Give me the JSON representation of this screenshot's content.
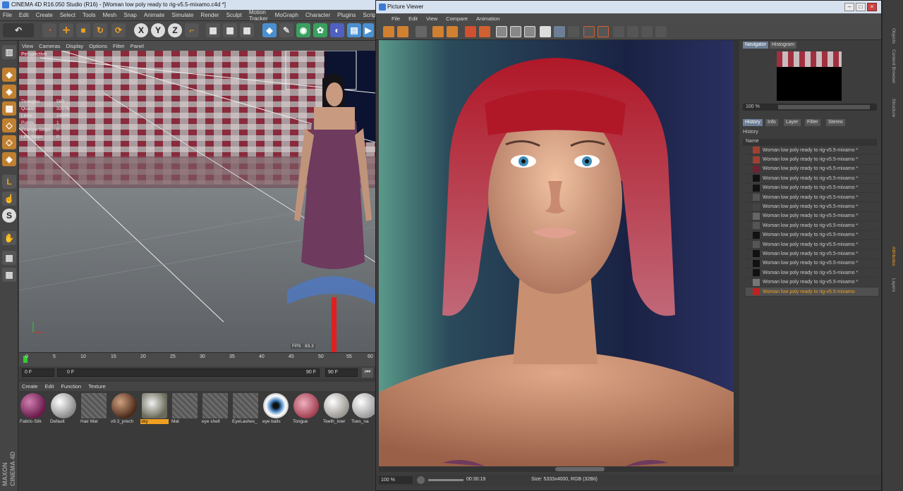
{
  "main_window": {
    "title": "CINEMA 4D R16.050 Studio (R16) - [Woman low poly ready to rig-v5.5-mixamo.c4d *]",
    "menu": [
      "File",
      "Edit",
      "Create",
      "Select",
      "Tools",
      "Mesh",
      "Snap",
      "Animate",
      "Simulate",
      "Render",
      "Sculpt",
      "Motion Tracker",
      "MoGraph",
      "Character",
      "Plugins",
      "Script"
    ]
  },
  "toolbar": {
    "x_label": "X",
    "y_label": "Y",
    "z_label": "Z"
  },
  "viewport": {
    "menu": [
      "View",
      "Cameras",
      "Display",
      "Options",
      "Filter",
      "Panel"
    ],
    "name": "Perspective",
    "stats": [
      {
        "label": "Triangles",
        "value": "560"
      },
      {
        "label": "Quads",
        "value": "32076"
      },
      {
        "label": "Lines",
        "value": "14109"
      },
      {
        "label": "Points",
        "value": "1"
      },
      {
        "label": "Triangle Strips",
        "value": "0"
      },
      {
        "label": "Line Strips",
        "value": "0"
      }
    ],
    "fps": "FPS : 83.3"
  },
  "timeline": {
    "ticks": [
      "0",
      "5",
      "10",
      "15",
      "20",
      "25",
      "30",
      "35",
      "40",
      "45",
      "50",
      "55",
      "60"
    ],
    "start_frame": "0 F",
    "min_frame": "0 F",
    "range_end": "90 F",
    "end_frame": "90 F"
  },
  "materials": {
    "menu": [
      "Create",
      "Edit",
      "Function",
      "Texture"
    ],
    "items": [
      {
        "label": "Fabric-Silk",
        "color": "#8a3068"
      },
      {
        "label": "Default",
        "color": "#cfcfcf"
      },
      {
        "label": "Hair Mat",
        "color": "hatch"
      },
      {
        "label": "v9.3_prech",
        "color": "#7a4a34"
      },
      {
        "label": "sky",
        "color": "#9a9a8a"
      },
      {
        "label": "Mat",
        "color": "hatch"
      },
      {
        "label": "eye shell",
        "color": "hatch"
      },
      {
        "label": "EyeLashes_",
        "color": "hatch"
      },
      {
        "label": "eye balls",
        "color": "#3a7ab8"
      },
      {
        "label": "Tongue",
        "color": "#d07080"
      },
      {
        "label": "Teeth_lowr",
        "color": "#d8d4cc"
      },
      {
        "label": "Toes_na",
        "color": "#d8d8d8"
      }
    ]
  },
  "brand": "MAXON CINEMA 4D",
  "picture_viewer": {
    "title": "Picture Viewer",
    "menu": [
      "File",
      "Edit",
      "View",
      "Compare",
      "Animation"
    ],
    "side_tabs_top": [
      "Navigator",
      "Histogram"
    ],
    "nav_zoom": "100 %",
    "side_tabs": [
      "History",
      "Info",
      "Layer",
      "Filter",
      "Stereo"
    ],
    "history_header": "History",
    "history_col": "Name",
    "history_items": [
      "Woman low poly ready to rig-v5.5-mixamo *",
      "Woman low poly ready to rig-v5.5-mixamo *",
      "Woman low poly ready to rig-v5.5-mixamo *",
      "Woman low poly ready to rig-v5.5-mixamo *",
      "Woman low poly ready to rig-v5.5-mixamo *",
      "Woman low poly ready to rig-v5.5-mixamo *",
      "Woman low poly ready to rig-v5.5-mixamo *",
      "Woman low poly ready to rig-v5.5-mixamo *",
      "Woman low poly ready to rig-v5.5-mixamo *",
      "Woman low poly ready to rig-v5.5-mixamo *",
      "Woman low poly ready to rig-v5.5-mixamo *",
      "Woman low poly ready to rig-v5.5-mixamo *",
      "Woman low poly ready to rig-v5.5-mixamo *",
      "Woman low poly ready to rig-v5.5-mixamo *",
      "Woman low poly ready to rig-v5.5-mixamo *",
      "Woman low poly ready to rig-v5.5-mixamo"
    ],
    "status_zoom": "100 %",
    "status_time": "00:30:19",
    "status_size": "Size: 5333x4000, RGB (32Bit)"
  },
  "right_strip": [
    "Objects",
    "Content Browser",
    "Structure",
    "Attributes",
    "Layers"
  ]
}
